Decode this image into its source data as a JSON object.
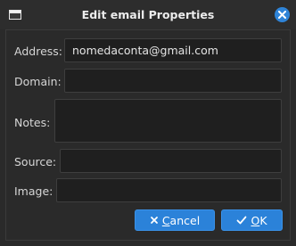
{
  "window": {
    "title": "Edit email Properties"
  },
  "fields": {
    "address": {
      "label": "Address:",
      "value": "nomedaconta@gmail.com"
    },
    "domain": {
      "label": "Domain:",
      "value": ""
    },
    "notes": {
      "label": "Notes:",
      "value": ""
    },
    "source": {
      "label": "Source:",
      "value": ""
    },
    "image": {
      "label": "Image:",
      "value": ""
    }
  },
  "buttons": {
    "cancel": {
      "mnemonic": "C",
      "rest": "ancel",
      "icon": "x-icon"
    },
    "ok": {
      "mnemonic": "O",
      "rest": "K",
      "icon": "check-icon"
    }
  },
  "colors": {
    "accent": "#2b82d9",
    "background": "#2a2a2a",
    "field": "#1f1f1f"
  }
}
